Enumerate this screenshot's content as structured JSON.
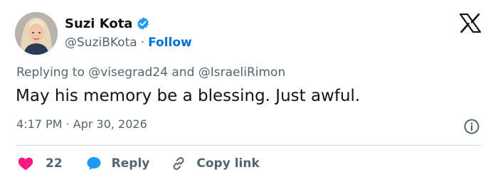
{
  "author": {
    "display_name": "Suzi Kota",
    "handle": "@SuziBKota",
    "separator": "·",
    "follow_label": "Follow",
    "avatar_icon": "avatar-portrait",
    "verified_icon": "verified-badge-icon"
  },
  "reply_context": {
    "prefix": "Replying to",
    "mention_1": "@visegrad24",
    "conjunction": "and",
    "mention_2": "@IsraeliRimon"
  },
  "tweet": {
    "text": "May his memory be a blessing. Just awful.",
    "time": "4:17 PM",
    "separator": "·",
    "date": "Apr 30, 2026"
  },
  "actions": {
    "like_count": "22",
    "reply_label": "Reply",
    "copy_link_label": "Copy link"
  },
  "colors": {
    "accent": "#1d9bf0",
    "follow": "#006fd6",
    "heart": "#f91880",
    "secondary_text": "#536471",
    "primary_text": "#0f1419"
  }
}
